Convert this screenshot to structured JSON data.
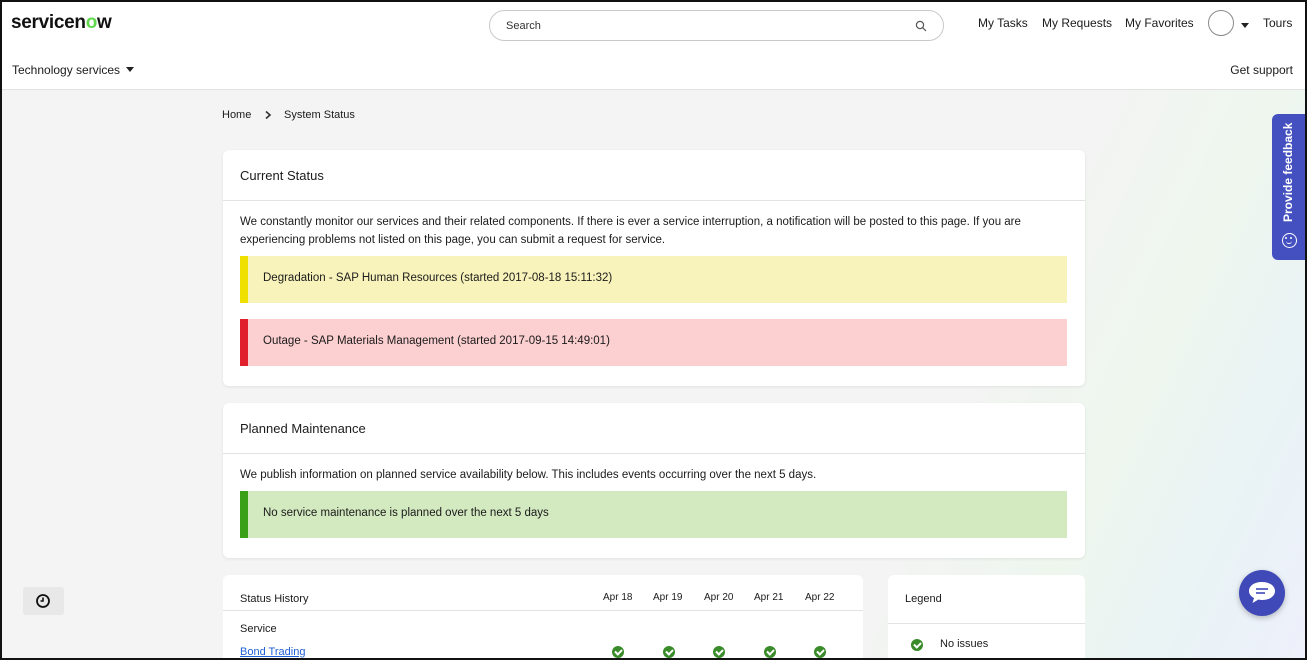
{
  "header": {
    "logo_text_pre": "servicen",
    "logo_text_o": "o",
    "logo_text_post": "w",
    "search_placeholder": "Search",
    "nav": {
      "my_tasks": "My Tasks",
      "my_requests": "My Requests",
      "my_favorites": "My Favorites",
      "tours": "Tours"
    },
    "services_menu": "Technology services",
    "get_support": "Get support"
  },
  "breadcrumb": {
    "home": "Home",
    "current": "System Status"
  },
  "current_status": {
    "title": "Current Status",
    "description": "We constantly monitor our services and their related components. If there is ever a service interruption, a notification will be posted to this page. If you are experiencing problems not listed on this page, you can submit a request for service.",
    "alerts": [
      {
        "text": "Degradation - SAP Human Resources (started 2017-08-18 15:11:32)",
        "bg": "#f8f3bb",
        "bar": "#f0e000"
      },
      {
        "text": "Outage - SAP Materials Management (started 2017-09-15 14:49:01)",
        "bg": "#fccfd0",
        "bar": "#e0202c"
      }
    ]
  },
  "planned_maintenance": {
    "title": "Planned Maintenance",
    "description": "We publish information on planned service availability below. This includes events occurring over the next 5 days.",
    "alert": {
      "text": "No service maintenance is planned over the next 5 days",
      "bg": "#d3e9c0",
      "bar": "#3aa018"
    }
  },
  "status_history": {
    "title": "Status History",
    "dates": [
      "Apr 18",
      "Apr 19",
      "Apr 20",
      "Apr 21",
      "Apr 22"
    ],
    "column_service": "Service",
    "rows": [
      {
        "service": "Bond Trading",
        "statuses": [
          "ok",
          "ok",
          "ok",
          "ok",
          "ok"
        ]
      }
    ]
  },
  "legend": {
    "title": "Legend",
    "items": [
      {
        "label": "No issues",
        "icon": "check-circle-icon"
      }
    ]
  },
  "feedback_tab": {
    "label": "Provide feedback"
  },
  "colors": {
    "brand_green": "#62d84e",
    "accent_blue": "#4450c0",
    "ok_green": "#3a8b2a",
    "link_blue": "#1f5fd6"
  }
}
